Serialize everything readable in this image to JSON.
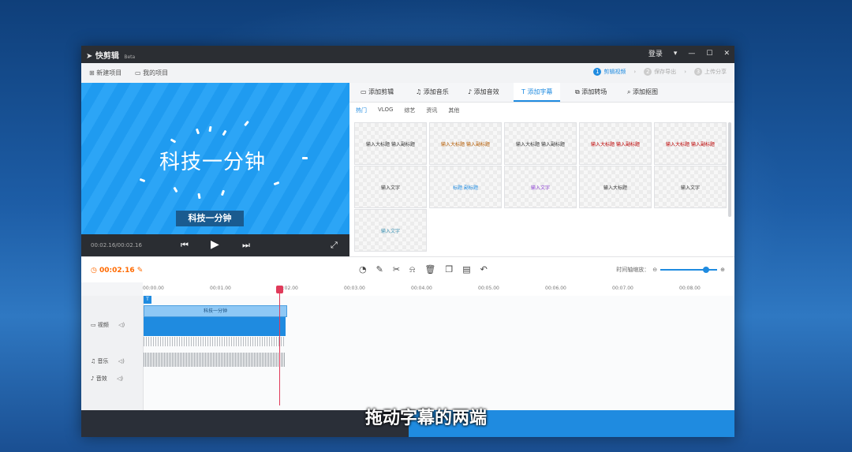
{
  "app": {
    "title": "快剪辑",
    "badge": "Beta"
  },
  "titlebar": {
    "login": "登录",
    "menu": "▾",
    "min": "—",
    "max": "☐",
    "close": "✕"
  },
  "toolbar": {
    "new_project": "新建项目",
    "my_projects": "我的项目"
  },
  "steps": [
    {
      "num": "1",
      "label": "剪辑视频",
      "active": true
    },
    {
      "num": "2",
      "label": "保存导出",
      "active": false
    },
    {
      "num": "3",
      "label": "上传分享",
      "active": false
    }
  ],
  "preview": {
    "big_title": "科技一分钟",
    "subtitle_box": "科技一分钟",
    "time": "00:02.16/00:02.16"
  },
  "tabs": [
    {
      "label": "添加剪辑",
      "active": false
    },
    {
      "label": "添加音乐",
      "active": false
    },
    {
      "label": "添加音效",
      "active": false
    },
    {
      "label": "添加字幕",
      "active": true
    },
    {
      "label": "添加转场",
      "active": false
    },
    {
      "label": "添加抠图",
      "active": false
    }
  ],
  "categories": [
    {
      "label": "热门",
      "active": true
    },
    {
      "label": "VLOG",
      "active": false
    },
    {
      "label": "综艺",
      "active": false
    },
    {
      "label": "资讯",
      "active": false
    },
    {
      "label": "其他",
      "active": false
    }
  ],
  "templates": [
    "输入大标题\n输入副标题",
    "输入大标题\n输入副标题",
    "输入大标题\n输入副标题",
    "输入大标题 输入副标题",
    "输入大标题 输入副标题",
    "输入文字",
    "标题 副标题",
    "输入文字",
    "输入大标题",
    "输入文字",
    "输入文字"
  ],
  "timeline": {
    "current_time": "00:02.16",
    "zoom_label": "时间轴缩放：",
    "ticks": [
      "00:00.00",
      "00:01.00",
      "00:02.00",
      "00:03.00",
      "00:04.00",
      "00:05.00",
      "00:06.00",
      "00:07.00",
      "00:08.00"
    ],
    "subtitle_clip": "科技一分钟",
    "tracks": [
      {
        "label": "视频"
      },
      {
        "label": "音乐"
      },
      {
        "label": "音效"
      }
    ]
  },
  "caption": "拖动字幕的两端",
  "colors": {
    "accent": "#1f8be0",
    "playhead": "#e03a5a",
    "time": "#ff6a00"
  }
}
